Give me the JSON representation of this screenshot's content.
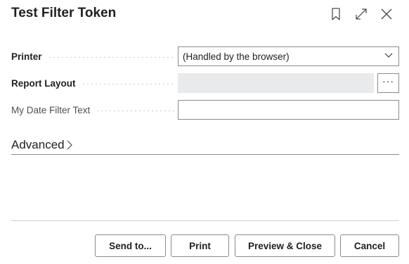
{
  "dialog": {
    "title": "Test Filter Token",
    "icons": {
      "bookmark": "bookmark-icon",
      "expand": "expand-icon",
      "close": "close-icon"
    }
  },
  "fields": {
    "printer": {
      "label": "Printer",
      "value": "(Handled by the browser)"
    },
    "report_layout": {
      "label": "Report Layout",
      "value": "",
      "assist_label": "···"
    },
    "date_filter": {
      "label": "My Date Filter Text",
      "value": ""
    }
  },
  "advanced": {
    "label": "Advanced"
  },
  "buttons": {
    "send_to": "Send to...",
    "print": "Print",
    "preview_close": "Preview & Close",
    "cancel": "Cancel"
  },
  "colors": {
    "text": "#212121",
    "border": "#8a8a8a",
    "readonly_bg": "#e9eaeb",
    "separator": "#d0d0d0"
  }
}
